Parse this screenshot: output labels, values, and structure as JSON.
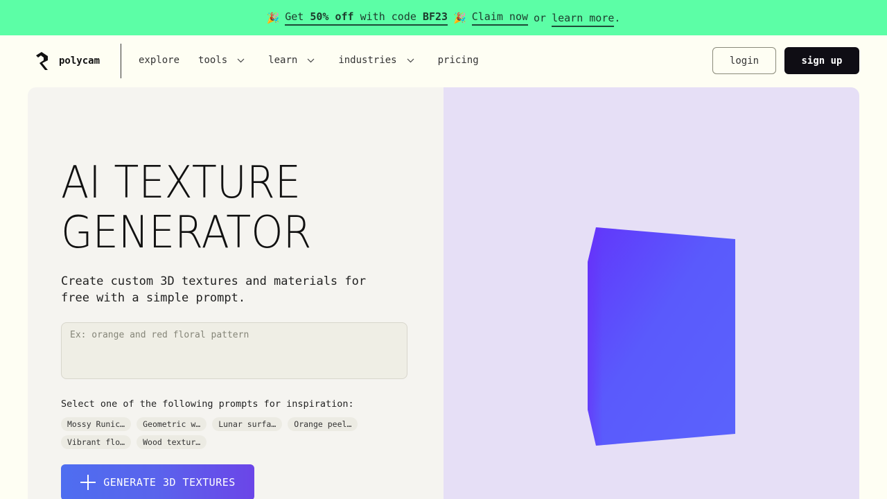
{
  "promo": {
    "get": "Get",
    "discount": "50% off",
    "with_code": "with code",
    "code": "BF23",
    "claim": "Claim now",
    "or": "or",
    "learn_more": "learn more",
    "period": ".",
    "party_icon": "🎉"
  },
  "nav": {
    "brand": "polycam",
    "links": [
      {
        "label": "explore",
        "dropdown": false
      },
      {
        "label": "tools",
        "dropdown": true
      },
      {
        "label": "learn",
        "dropdown": true
      },
      {
        "label": "industries",
        "dropdown": true
      },
      {
        "label": "pricing",
        "dropdown": false
      }
    ],
    "login": "login",
    "signup": "sign up"
  },
  "hero": {
    "title_line1": "AI TEXTURE",
    "title_line2": "GENERATOR",
    "subtitle": "Create custom 3D textures and materials for free with a simple prompt.",
    "input_placeholder": "Ex: orange and red floral pattern",
    "input_value": "",
    "inspiration_label": "Select one of the following prompts for inspiration:",
    "chips": [
      "Mossy Runic…",
      "Geometric w…",
      "Lunar surfa…",
      "Orange peel…",
      "Vibrant flo…",
      "Wood textur…"
    ],
    "generate_label": "GENERATE 3D TEXTURES"
  },
  "colors": {
    "promo_bg": "#5cfea6",
    "page_bg": "#fefef3",
    "left_panel_bg": "#f5f4f0",
    "right_panel_bg": "#e6dff6",
    "cube_start": "#6236fb",
    "cube_end": "#5a63fc",
    "cta_start": "#4e6ef0",
    "cta_end": "#6b45e8"
  }
}
